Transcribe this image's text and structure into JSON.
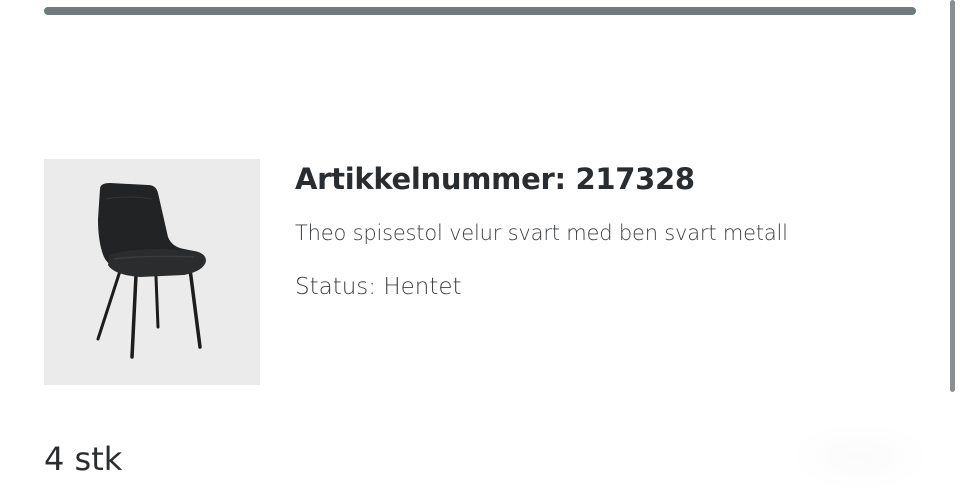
{
  "product": {
    "article_number": "Artikkelnummer: 217328",
    "description": "Theo spisestol velur svart med ben svart metall",
    "status": "Status: Hentet",
    "image_icon": "chair-image"
  },
  "quantity": "4 stk",
  "colors": {
    "progress": "#6e7a7b",
    "image_bg": "#ebebeb",
    "text": "#2a2d2f"
  }
}
